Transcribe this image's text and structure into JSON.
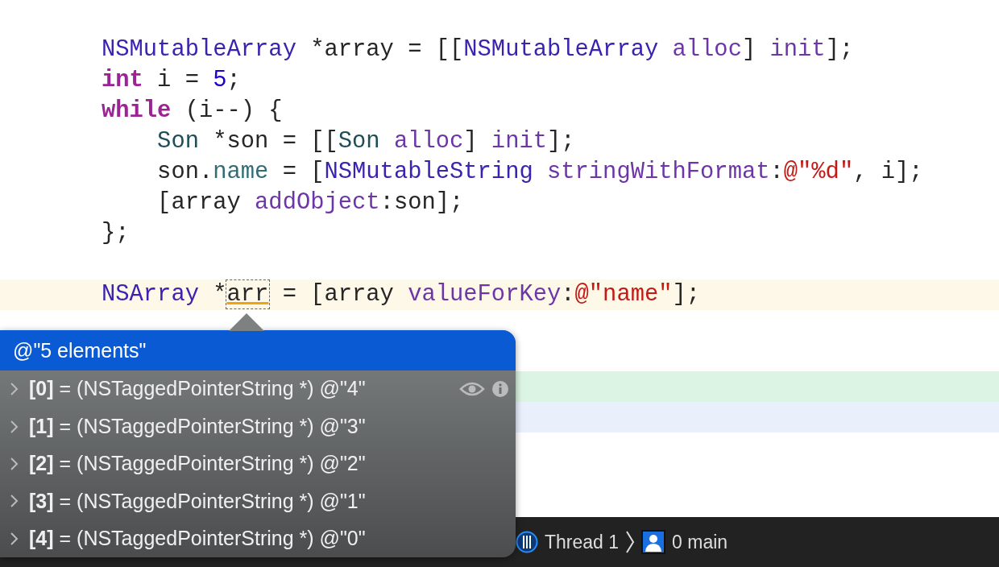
{
  "code_lines": [
    {
      "kind": "code",
      "tokens": [
        {
          "kind": "type",
          "text": "NSMutableArray"
        },
        {
          "kind": "plain",
          "text": " *array = [["
        },
        {
          "kind": "type",
          "text": "NSMutableArray"
        },
        {
          "kind": "method",
          "text": "alloc"
        },
        {
          "kind": "plain",
          "text": "] "
        },
        {
          "kind": "method",
          "text": "init"
        },
        {
          "kind": "plain",
          "text": "];"
        }
      ]
    },
    {
      "kind": "code",
      "tokens": [
        {
          "kind": "keyword",
          "text": "int"
        },
        {
          "kind": "plain",
          "text": " i = "
        },
        {
          "kind": "number",
          "text": "5"
        },
        {
          "kind": "plain",
          "text": ";"
        }
      ]
    },
    {
      "kind": "code",
      "tokens": [
        {
          "kind": "keyword",
          "text": "while"
        },
        {
          "kind": "plain",
          "text": " (i--) {"
        }
      ],
      "children": [
        {
          "kind": "code",
          "tokens": [
            {
              "kind": "class",
              "text": "Son"
            },
            {
              "kind": "plain",
              "text": " *son = [["
            },
            {
              "kind": "class",
              "text": "Son"
            },
            {
              "kind": "method",
              "text": "alloc"
            },
            {
              "kind": "plain",
              "text": "] "
            },
            {
              "kind": "method",
              "text": "init"
            },
            {
              "kind": "plain",
              "text": "];"
            }
          ]
        },
        {
          "kind": "code",
          "tokens": [
            {
              "kind": "plain",
              "text": "son."
            },
            {
              "kind": "property",
              "text": "name"
            },
            {
              "kind": "plain",
              "text": " = ["
            },
            {
              "kind": "type",
              "text": "NSMutableString"
            },
            {
              "kind": "method",
              "text": "stringWithFormat"
            },
            {
              "kind": "plain",
              "text": ":"
            },
            {
              "kind": "string",
              "text": "@\"%d\""
            },
            {
              "kind": "plain",
              "text": ", i];"
            }
          ]
        },
        {
          "kind": "code",
          "tokens": [
            {
              "kind": "plain",
              "text": "[array "
            },
            {
              "kind": "method",
              "text": "addObject"
            },
            {
              "kind": "plain",
              "text": ":son];"
            }
          ]
        }
      ]
    },
    {
      "kind": "code",
      "tokens": [
        {
          "kind": "plain",
          "text": "};"
        }
      ]
    },
    {
      "kind": "code"
    },
    {
      "kind": "cursor",
      "tokens": [
        {
          "kind": "type",
          "text": "NSArray"
        },
        {
          "kind": "plain",
          "text": " *"
        },
        {
          "kind": "hover",
          "text": "arr"
        },
        {
          "kind": "plain",
          "text": " = [array "
        },
        {
          "kind": "method",
          "text": "valueForKey"
        },
        {
          "kind": "plain",
          "text": ":"
        },
        {
          "kind": "string",
          "text": "@\"name\""
        },
        {
          "kind": "plain",
          "text": "];"
        }
      ]
    },
    {
      "kind": "code"
    },
    {
      "kind": "code"
    },
    {
      "kind": "pc"
    },
    {
      "kind": "selection"
    }
  ],
  "popup": {
    "title": "@\"5 elements\"",
    "rows": [
      {
        "index": "[0]",
        "value": "= (NSTaggedPointerString *) @\"4\"",
        "expanded": false,
        "hovered": true
      },
      {
        "index": "[1]",
        "value": "= (NSTaggedPointerString *) @\"3\"",
        "expanded": false,
        "hovered": false
      },
      {
        "index": "[2]",
        "value": "= (NSTaggedPointerString *) @\"2\"",
        "expanded": false,
        "hovered": false
      },
      {
        "index": "[3]",
        "value": "= (NSTaggedPointerString *) @\"1\"",
        "expanded": false,
        "hovered": false
      },
      {
        "index": "[4]",
        "value": "= (NSTaggedPointerString *) @\"0\"",
        "expanded": false,
        "hovered": false
      }
    ]
  },
  "debug_bar": {
    "thread": "Thread 1",
    "frame": "0 main"
  }
}
